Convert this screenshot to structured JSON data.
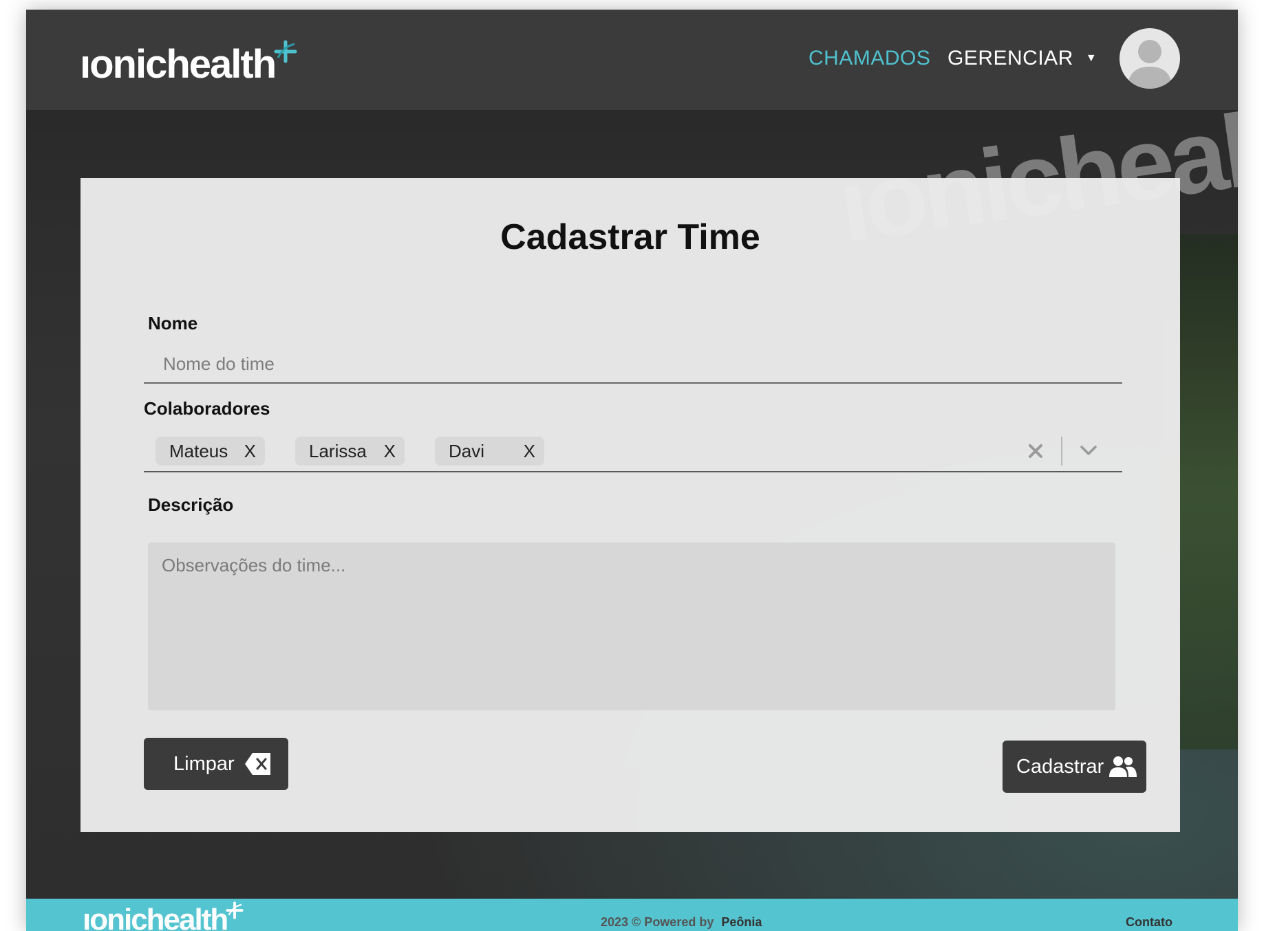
{
  "header": {
    "logo_text": "ıonichealth",
    "nav": {
      "chamados": "CHAMADOS",
      "gerenciar": "GERENCIAR",
      "gerenciar_caret": "▼"
    }
  },
  "background": {
    "brand_text": "ıonichealt"
  },
  "form": {
    "title": "Cadastrar Time",
    "nome": {
      "label": "Nome",
      "placeholder": "Nome do time",
      "value": ""
    },
    "colaboradores": {
      "label": "Colaboradores",
      "selected": [
        {
          "name": "Mateus",
          "remove": "X"
        },
        {
          "name": "Larissa",
          "remove": "X"
        },
        {
          "name": "Davi",
          "remove": "X"
        }
      ]
    },
    "descricao": {
      "label": "Descrição",
      "placeholder": "Observações do time...",
      "value": ""
    },
    "buttons": {
      "limpar": "Limpar",
      "cadastrar": "Cadastrar"
    }
  },
  "footer": {
    "logo_text": "ıonichealth",
    "copyright": "2023 © Powered by",
    "company": "Peônia",
    "contato": "Contato"
  },
  "colors": {
    "accent": "#4fc2cf",
    "footer_bg": "#54c4d0",
    "header_bg": "#3b3b3b",
    "button_bg": "#3b3b3b",
    "card_bg": "#ebebeb"
  },
  "icons": {
    "logo": "plus-swoosh-icon",
    "avatar": "user-avatar-icon",
    "clear": "x-icon",
    "dropdown": "chevron-down-icon",
    "limpar": "backspace-icon",
    "cadastrar": "user-group-icon"
  }
}
